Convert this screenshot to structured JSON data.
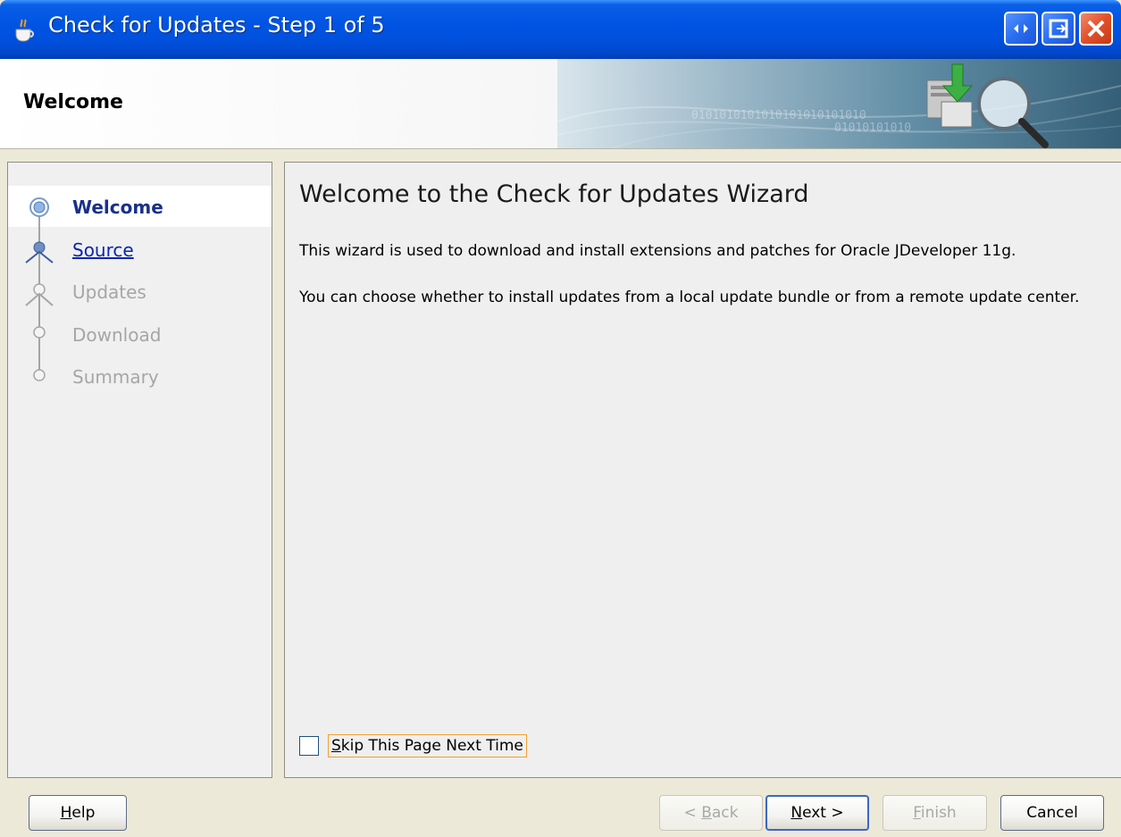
{
  "window": {
    "title": "Check for Updates - Step 1 of 5",
    "icon": "java-cup-icon",
    "controls": [
      "restore-icon",
      "maximize-icon",
      "close-icon"
    ]
  },
  "banner": {
    "heading": "Welcome",
    "binary_text_1": "0101010101010101010101010",
    "binary_text_2": "01010101010",
    "icon": "updates-magnifier-icon"
  },
  "steps": [
    {
      "label": "Welcome",
      "state": "current"
    },
    {
      "label": "Source",
      "state": "link"
    },
    {
      "label": "Updates",
      "state": "disabled"
    },
    {
      "label": "Download",
      "state": "disabled"
    },
    {
      "label": "Summary",
      "state": "disabled"
    }
  ],
  "content": {
    "title": "Welcome to the Check for Updates Wizard",
    "paragraph1": "This wizard is used to download and install extensions and patches for Oracle JDeveloper 11g.",
    "paragraph2": "You can choose whether to install updates from a local update bundle or from a remote update center.",
    "skip_checkbox": {
      "first": "S",
      "rest": "kip This Page Next Time",
      "checked": false
    }
  },
  "buttons": {
    "help": {
      "mnemonic": "H",
      "rest": "elp"
    },
    "back": {
      "prefix": "< ",
      "mnemonic": "B",
      "rest": "ack",
      "enabled": false
    },
    "next": {
      "mnemonic": "N",
      "rest": "ext >",
      "enabled": true
    },
    "finish": {
      "mnemonic": "F",
      "rest": "inish",
      "enabled": false
    },
    "cancel": {
      "label": "Cancel"
    }
  },
  "colors": {
    "titlebar": "#0054E3",
    "current_step": "#18308C",
    "link_step": "#0826B0",
    "disabled_step": "#A6A6A6",
    "focus_outline": "#F0A030"
  }
}
